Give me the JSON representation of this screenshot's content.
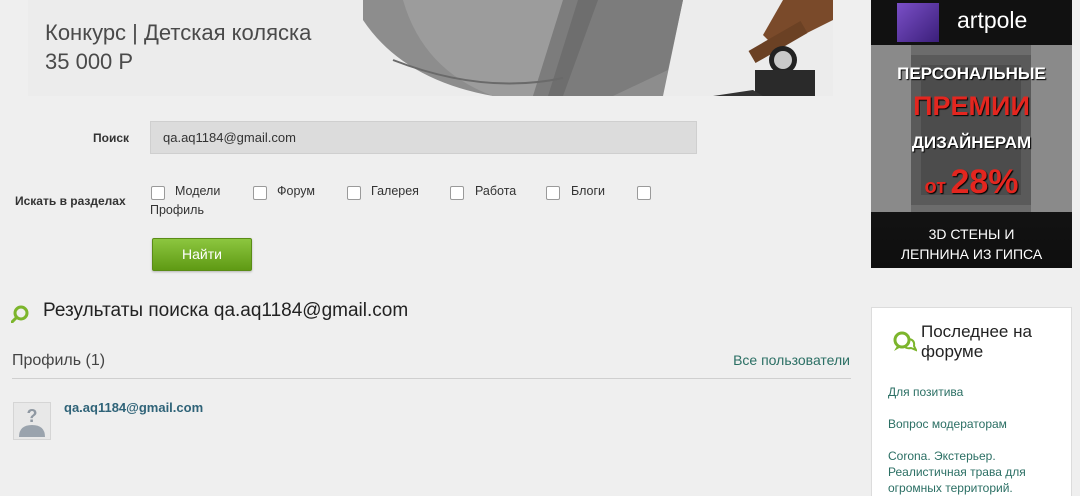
{
  "banner": {
    "title": "Конкурс | Детская коляска",
    "price": "35 000 Р"
  },
  "search": {
    "label": "Поиск",
    "value": "qa.aq1184@gmail.com",
    "sections_label": "Искать в разделах",
    "sections": [
      "Модели",
      "Форум",
      "Галерея",
      "Работа",
      "Блоги",
      "Профиль"
    ],
    "submit_label": "Найти"
  },
  "results": {
    "title": "Результаты поиска qa.aq1184@gmail.com",
    "section_heading": "Профиль (1)",
    "all_users_link": "Все пользователи",
    "users": [
      "qa.aq1184@gmail.com"
    ]
  },
  "ad": {
    "brand": "artpole",
    "line1": "ПЕРСОНАЛЬНЫЕ",
    "line2": "ПРЕМИИ",
    "line3": "ДИЗАЙНЕРАМ",
    "line4_prefix": "от",
    "line4_value": "28%",
    "bottom1": "3D СТЕНЫ И",
    "bottom2": "ЛЕПНИНА ИЗ ГИПСА"
  },
  "forum": {
    "title": "Последнее на форуме",
    "links": [
      "Для позитива",
      "Вопрос модераторам",
      "Corona. Экстерьер. Реалистичная трава для огромных территорий."
    ]
  },
  "colors": {
    "accent_green": "#6aa61f",
    "link_teal": "#2b6f64",
    "background": "#efefef",
    "ad_red": "#e3261f"
  }
}
